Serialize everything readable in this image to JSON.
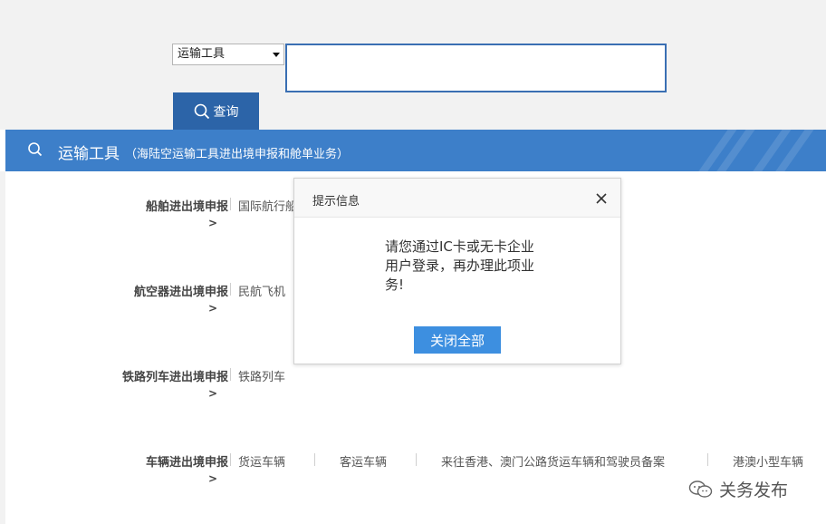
{
  "search": {
    "select_value": "运输工具",
    "query_label": "查询"
  },
  "banner": {
    "title": "运输工具",
    "subtitle": "（海陆空运输工具进出境申报和舱单业务）"
  },
  "categories": [
    {
      "label": "船舶进出境申报",
      "arrow": ">",
      "items": [
        "国际航行船舶"
      ]
    },
    {
      "label": "航空器进出境申报",
      "arrow": ">",
      "items": [
        "民航飞机"
      ]
    },
    {
      "label": "铁路列车进出境申报",
      "arrow": ">",
      "items": [
        "铁路列车"
      ]
    },
    {
      "label": "车辆进出境申报",
      "arrow": ">",
      "items": [
        "货运车辆",
        "客运车辆",
        "来往香港、澳门公路货运车辆和驾驶员备案",
        "港澳小型车辆"
      ]
    }
  ],
  "dialog": {
    "title": "提示信息",
    "message": "请您通过IC卡或无卡企业用户登录，再办理此项业务!",
    "button_label": "关闭全部"
  },
  "watermark": {
    "text": "关务发布"
  },
  "colors": {
    "brand_blue": "#2c64a8",
    "banner_blue": "#3d7fc9",
    "dialog_button": "#3d8fe0"
  }
}
